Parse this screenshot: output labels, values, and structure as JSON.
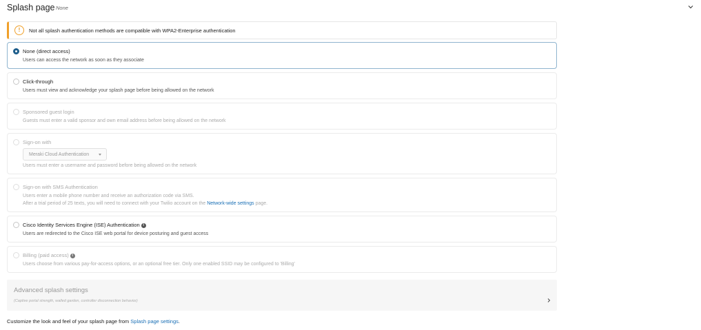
{
  "header": {
    "title": "Splash page",
    "current_value": "None",
    "collapse_icon": "chevron-down-icon"
  },
  "warning": {
    "icon": "exclamation-circle-icon",
    "icon_glyph": "!",
    "text": "Not all splash authentication methods are compatible with WPA2-Enterprise authentication",
    "accent_color": "#f0a02a"
  },
  "options": {
    "none": {
      "title": "None (direct access)",
      "desc": "Users can access the network as soon as they associate",
      "selected": true
    },
    "click_through": {
      "title": "Click-through",
      "desc": "Users must view and acknowledge your splash page before being allowed on the network"
    },
    "sponsored": {
      "title": "Sponsored guest login",
      "desc": "Guests must enter a valid sponsor and own email address before being allowed on the network",
      "disabled": true
    },
    "sign_on": {
      "title": "Sign-on with",
      "dropdown_value": "Meraki Cloud Authentication",
      "desc": "Users must enter a username and password before being allowed on the network",
      "disabled": true
    },
    "sms": {
      "title": "Sign-on with SMS Authentication",
      "desc_line1": "Users enter a mobile phone number and receive an authorization code via SMS.",
      "desc_line2_prefix": "After a trial period of 25 texts, you will need to connect with your Twilio account on the ",
      "desc_line2_link": "Network-wide settings",
      "desc_line2_suffix": " page.",
      "disabled": true
    },
    "ise": {
      "title": "Cisco Identity Services Engine (ISE) Authentication",
      "desc": "Users are redirected to the Cisco ISE web portal for device posturing and guest access",
      "info_icon": "info-icon"
    },
    "billing": {
      "title": "Billing (paid access)",
      "desc": "Users choose from various pay-for-access options, or an optional free tier. Only one enabled SSID may be configured to 'Billing'",
      "info_icon": "info-icon",
      "disabled": true
    }
  },
  "advanced": {
    "title": "Advanced splash settings",
    "subtitle": "(Captive portal strength, walled garden, controller disconnection behavior)",
    "chevron_icon": "chevron-right-icon"
  },
  "footer": {
    "prefix": "Customize the look and feel of your splash page from ",
    "link": "Splash page settings",
    "suffix": "."
  },
  "colors": {
    "accent_blue": "#1d5d8b",
    "link_blue": "#1a6fb5",
    "selected_border": "#8fb4cf",
    "warning_orange": "#f0a02a"
  }
}
